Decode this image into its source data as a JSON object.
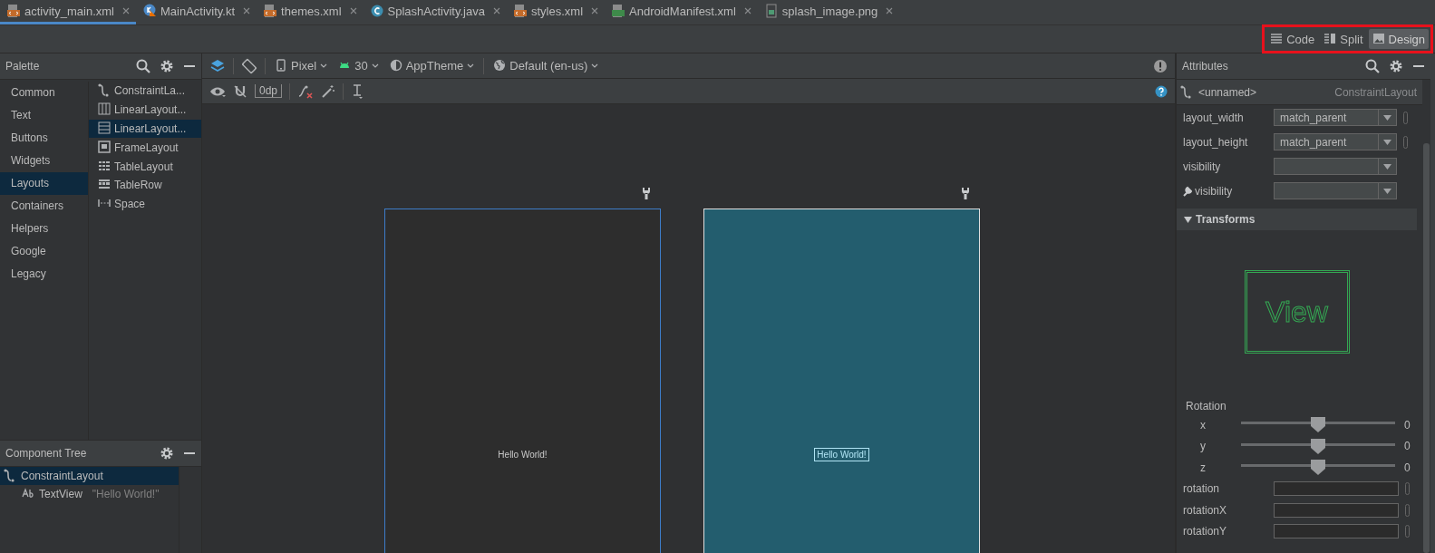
{
  "tabs": [
    {
      "label": "activity_main.xml",
      "kind": "xml",
      "selected": true
    },
    {
      "label": "MainActivity.kt",
      "kind": "kotlin",
      "selected": false
    },
    {
      "label": "themes.xml",
      "kind": "xml",
      "selected": false
    },
    {
      "label": "SplashActivity.java",
      "kind": "class",
      "selected": false
    },
    {
      "label": "styles.xml",
      "kind": "xml",
      "selected": false
    },
    {
      "label": "AndroidManifest.xml",
      "kind": "manifest",
      "selected": false
    },
    {
      "label": "splash_image.png",
      "kind": "image",
      "selected": false
    }
  ],
  "view_modes": {
    "highlighted": true,
    "items": [
      {
        "label": "Code",
        "kind": "code",
        "selected": false
      },
      {
        "label": "Split",
        "kind": "split",
        "selected": false
      },
      {
        "label": "Design",
        "kind": "design",
        "selected": true
      }
    ]
  },
  "palette": {
    "title": "Palette",
    "categories": [
      {
        "label": "Common",
        "selected": false
      },
      {
        "label": "Text",
        "selected": false
      },
      {
        "label": "Buttons",
        "selected": false
      },
      {
        "label": "Widgets",
        "selected": false
      },
      {
        "label": "Layouts",
        "selected": true
      },
      {
        "label": "Containers",
        "selected": false
      },
      {
        "label": "Helpers",
        "selected": false
      },
      {
        "label": "Google",
        "selected": false
      },
      {
        "label": "Legacy",
        "selected": false
      }
    ],
    "items": [
      {
        "label": "ConstraintLa...",
        "kind": "constraint",
        "selected": false
      },
      {
        "label": "LinearLayout...",
        "kind": "columns",
        "selected": false
      },
      {
        "label": "LinearLayout...",
        "kind": "rows",
        "selected": true
      },
      {
        "label": "FrameLayout",
        "kind": "frame",
        "selected": false
      },
      {
        "label": "TableLayout",
        "kind": "table",
        "selected": false
      },
      {
        "label": "TableRow",
        "kind": "tablerow",
        "selected": false
      },
      {
        "label": "Space",
        "kind": "space",
        "selected": false
      }
    ]
  },
  "component_tree": {
    "title": "Component Tree",
    "nodes": [
      {
        "label": "ConstraintLayout",
        "kind": "constraint",
        "selected": true,
        "children": [
          {
            "label": "TextView",
            "hint": "\"Hello World!\"",
            "kind": "text",
            "selected": false
          }
        ]
      }
    ]
  },
  "editor": {
    "toolbar": [
      {
        "label": "Pixel",
        "kind": "phone"
      },
      {
        "label": "30",
        "kind": "android"
      },
      {
        "label": "AppTheme",
        "kind": "theme"
      },
      {
        "label": "Default (en-us)",
        "kind": "globe"
      }
    ],
    "margin": "0dp",
    "design_text": "Hello World!",
    "blueprint_text": "Hello World!"
  },
  "attributes": {
    "title": "Attributes",
    "component": "<unnamed>",
    "component_type": "ConstraintLayout",
    "fields": [
      {
        "label": "layout_width",
        "value": "match_parent",
        "kind": "dropdown"
      },
      {
        "label": "layout_height",
        "value": "match_parent",
        "kind": "dropdown"
      },
      {
        "label": "visibility",
        "kind": "dropdown"
      },
      {
        "label": "visibility",
        "kind": "tool-dropdown"
      }
    ],
    "section": {
      "title": "Transforms",
      "expanded": true
    },
    "preview_text": "View",
    "rotation": {
      "title": "Rotation",
      "sliders": [
        {
          "axis": "x",
          "level": 0.5,
          "reading": "0"
        },
        {
          "axis": "y",
          "level": 0.5,
          "reading": "0"
        },
        {
          "axis": "z",
          "level": 0.5,
          "reading": "0"
        }
      ]
    },
    "rotation_fields": [
      {
        "label": "rotation"
      },
      {
        "label": "rotationX"
      },
      {
        "label": "rotationY"
      }
    ]
  }
}
